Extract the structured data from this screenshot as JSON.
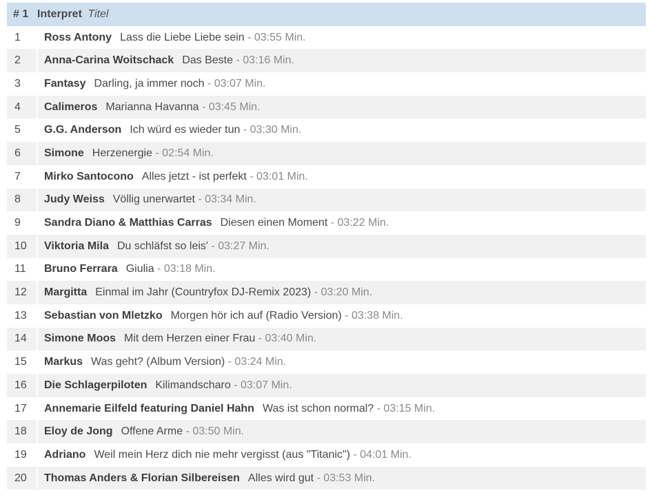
{
  "header": {
    "rank": "# 1",
    "interpret": "Interpret",
    "title": "Titel"
  },
  "rows": [
    {
      "rank": "1",
      "artist": "Ross Antony",
      "title": "Lass die Liebe Liebe sein",
      "duration": "03:55 Min."
    },
    {
      "rank": "2",
      "artist": "Anna-Carina Woitschack",
      "title": "Das Beste",
      "duration": "03:16 Min."
    },
    {
      "rank": "3",
      "artist": "Fantasy",
      "title": "Darling, ja immer noch",
      "duration": "03:07 Min."
    },
    {
      "rank": "4",
      "artist": "Calimeros",
      "title": "Marianna Havanna",
      "duration": "03:45 Min."
    },
    {
      "rank": "5",
      "artist": "G.G. Anderson",
      "title": "Ich würd es wieder tun",
      "duration": "03:30 Min."
    },
    {
      "rank": "6",
      "artist": "Simone",
      "title": "Herzenergie",
      "duration": "02:54 Min."
    },
    {
      "rank": "7",
      "artist": "Mirko Santocono",
      "title": "Alles jetzt - ist perfekt",
      "duration": "03:01 Min."
    },
    {
      "rank": "8",
      "artist": "Judy Weiss",
      "title": "Völlig unerwartet",
      "duration": "03:34 Min."
    },
    {
      "rank": "9",
      "artist": "Sandra Diano & Matthias Carras",
      "title": "Diesen einen Moment",
      "duration": "03:22 Min."
    },
    {
      "rank": "10",
      "artist": "Viktoria Mila",
      "title": "Du schläfst so leis'",
      "duration": "03:27 Min."
    },
    {
      "rank": "11",
      "artist": "Bruno Ferrara",
      "title": "Giulia",
      "duration": "03:18 Min."
    },
    {
      "rank": "12",
      "artist": "Margitta",
      "title": "Einmal im Jahr (Countryfox DJ-Remix 2023)",
      "duration": "03:20 Min."
    },
    {
      "rank": "13",
      "artist": "Sebastian von Mletzko",
      "title": "Morgen hör ich auf (Radio Version)",
      "duration": "03:38 Min."
    },
    {
      "rank": "14",
      "artist": "Simone Moos",
      "title": "Mit dem Herzen einer Frau",
      "duration": "03:40 Min."
    },
    {
      "rank": "15",
      "artist": "Markus",
      "title": "Was geht? (Album Version)",
      "duration": "03:24 Min."
    },
    {
      "rank": "16",
      "artist": "Die Schlagerpiloten",
      "title": "Kilimandscharo",
      "duration": "03:07 Min."
    },
    {
      "rank": "17",
      "artist": "Annemarie Eilfeld featuring Daniel Hahn",
      "title": "Was ist schon normal?",
      "duration": "03:15 Min."
    },
    {
      "rank": "18",
      "artist": "Eloy de Jong",
      "title": "Offene Arme",
      "duration": "03:50 Min."
    },
    {
      "rank": "19",
      "artist": "Adriano",
      "title": "Weil mein Herz dich nie mehr vergisst (aus \"Titanic\")",
      "duration": "04:01 Min."
    },
    {
      "rank": "20",
      "artist": "Thomas Anders & Florian Silbereisen",
      "title": "Alles wird gut",
      "duration": "03:53 Min."
    }
  ],
  "separator": " - ",
  "colors": {
    "header_bg": "#cfdff0",
    "row_alt_bg": "#f1f1f1",
    "duration_text": "#8a8a8a"
  }
}
